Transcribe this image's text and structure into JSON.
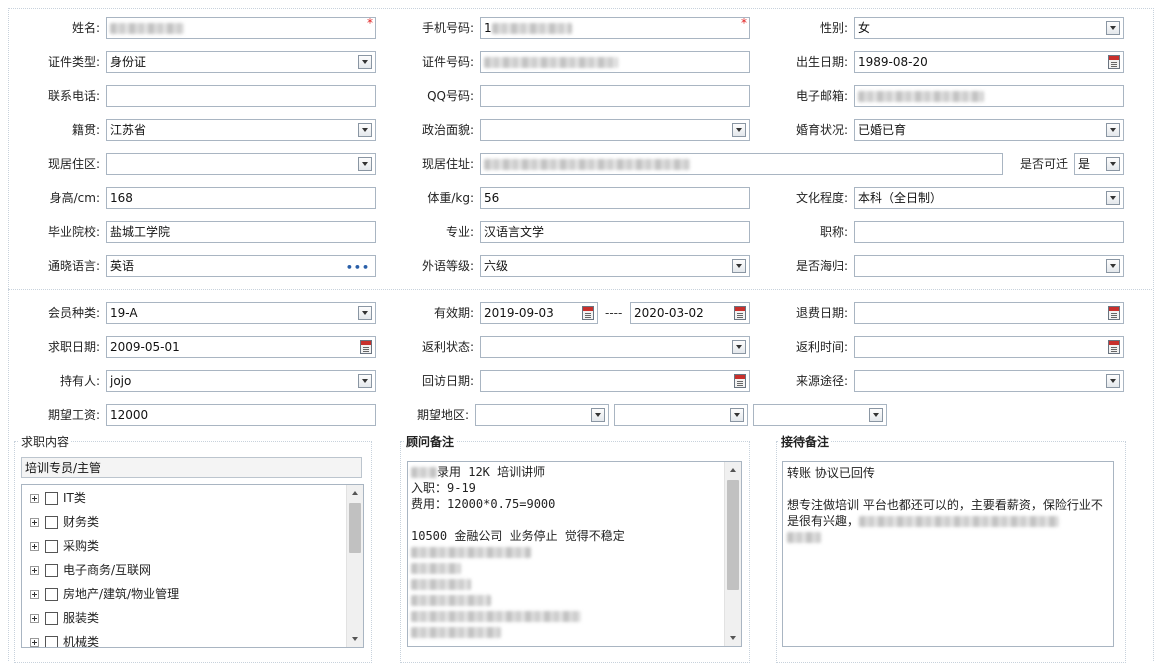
{
  "personal": {
    "name": {
      "label": "姓名:",
      "value": ""
    },
    "mobile": {
      "label": "手机号码:",
      "value": "1"
    },
    "gender": {
      "label": "性别:",
      "value": "女"
    },
    "id_type": {
      "label": "证件类型:",
      "value": "身份证"
    },
    "id_number": {
      "label": "证件号码:",
      "value": ""
    },
    "birth_date": {
      "label": "出生日期:",
      "value": "1989-08-20"
    },
    "phone": {
      "label": "联系电话:",
      "value": ""
    },
    "qq": {
      "label": "QQ号码:",
      "value": ""
    },
    "email": {
      "label": "电子邮箱:",
      "value": ""
    },
    "native_place": {
      "label": "籍贯:",
      "value": "江苏省"
    },
    "political": {
      "label": "政治面貌:",
      "value": ""
    },
    "marital": {
      "label": "婚育状况:",
      "value": "已婚已育"
    },
    "residence_area": {
      "label": "现居住区:",
      "value": ""
    },
    "residence_address": {
      "label": "现居住址:",
      "value": ""
    },
    "relocate": {
      "label": "是否可迁",
      "value": "是"
    },
    "height": {
      "label": "身高/cm:",
      "value": "168"
    },
    "weight": {
      "label": "体重/kg:",
      "value": "56"
    },
    "education": {
      "label": "文化程度:",
      "value": "本科（全日制）"
    },
    "school": {
      "label": "毕业院校:",
      "value": "盐城工学院"
    },
    "major": {
      "label": "专业:",
      "value": "汉语言文学"
    },
    "title": {
      "label": "职称:",
      "value": ""
    },
    "language": {
      "label": "通晓语言:",
      "value": "英语"
    },
    "foreign_level": {
      "label": "外语等级:",
      "value": "六级"
    },
    "overseas": {
      "label": "是否海归:",
      "value": ""
    }
  },
  "membership": {
    "member_type": {
      "label": "会员种类:",
      "value": "19-A"
    },
    "validity": {
      "label": "有效期:",
      "start": "2019-09-03",
      "separator": "----",
      "end": "2020-03-02"
    },
    "refund_date": {
      "label": "退费日期:",
      "value": ""
    },
    "job_date": {
      "label": "求职日期:",
      "value": "2009-05-01"
    },
    "rebate_status": {
      "label": "返利状态:",
      "value": ""
    },
    "rebate_time": {
      "label": "返利时间:",
      "value": ""
    },
    "holder": {
      "label": "持有人:",
      "value": "jojo"
    },
    "visit_date": {
      "label": "回访日期:",
      "value": ""
    },
    "source": {
      "label": "来源途径:",
      "value": ""
    },
    "salary": {
      "label": "期望工资:",
      "value": "12000"
    },
    "region": {
      "label": "期望地区:",
      "values": [
        "",
        "",
        ""
      ]
    }
  },
  "job_content": {
    "title": "求职内容",
    "selected": "培训专员/主管",
    "categories": [
      "IT类",
      "财务类",
      "采购类",
      "电子商务/互联网",
      "房地产/建筑/物业管理",
      "服装类",
      "机械类"
    ]
  },
  "advisor_notes": {
    "title": "顾问备注",
    "lines": [
      "录用 12K 培训讲师",
      "入职：9-19",
      "费用：12000*0.75=9000",
      "",
      "10500  金融公司  业务停止  觉得不稳定"
    ]
  },
  "reception_notes": {
    "title": "接待备注",
    "line1": "转账 协议已回传",
    "line2": "想专注做培训 平台也都还可以的，主要看薪资，保险行业不是很有兴趣，"
  }
}
